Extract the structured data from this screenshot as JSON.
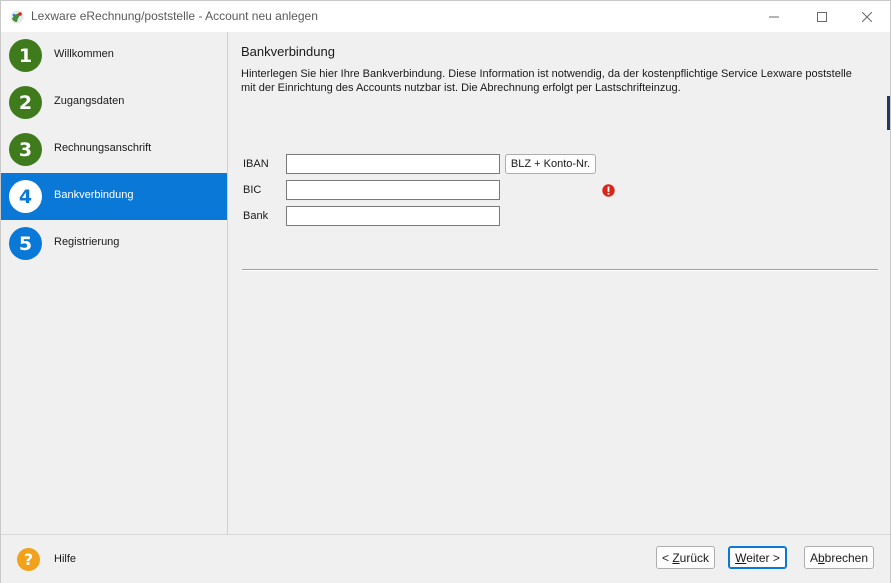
{
  "window": {
    "title": "Lexware eRechnung/poststelle - Account neu anlegen",
    "icons": {
      "app": "lexware-logo-icon",
      "minimize": "minimize-icon",
      "maximize": "maximize-icon",
      "close": "close-icon"
    }
  },
  "sidebar": {
    "steps": [
      {
        "number": "1",
        "label": "Willkommen",
        "state": "done"
      },
      {
        "number": "2",
        "label": "Zugangsdaten",
        "state": "done"
      },
      {
        "number": "3",
        "label": "Rechnungsanschrift",
        "state": "done"
      },
      {
        "number": "4",
        "label": "Bankverbindung",
        "state": "current"
      },
      {
        "number": "5",
        "label": "Registrierung",
        "state": "todo"
      }
    ]
  },
  "main": {
    "title": "Bankverbindung",
    "description": "Hinterlegen Sie hier Ihre Bankverbindung. Diese Information ist notwendig, da der kostenpflichtige Service Lexware poststelle mit der Einrichtung des Accounts nutzbar ist. Die Abrechnung erfolgt per Lastschrifteinzug.",
    "fields": {
      "iban": {
        "label": "IBAN",
        "value": ""
      },
      "bic": {
        "label": "BIC",
        "value": ""
      },
      "bank": {
        "label": "Bank",
        "value": ""
      }
    },
    "blz_button": "BLZ + Konto-Nr.",
    "validation_icon": "error-exclamation-icon"
  },
  "footer": {
    "help_symbol": "?",
    "help_label": "Hilfe",
    "back": {
      "mnemonic": "Z",
      "rest_prefix": "< ",
      "rest": "urück"
    },
    "next": {
      "mnemonic": "W",
      "rest": "eiter >"
    },
    "cancel": {
      "mnemonic": "b",
      "prefix": "A",
      "rest": "brechen"
    }
  },
  "colors": {
    "accent": "#0a78d7",
    "step_done": "#3f7a1d",
    "help": "#f2a21a",
    "error": "#d9261c"
  }
}
